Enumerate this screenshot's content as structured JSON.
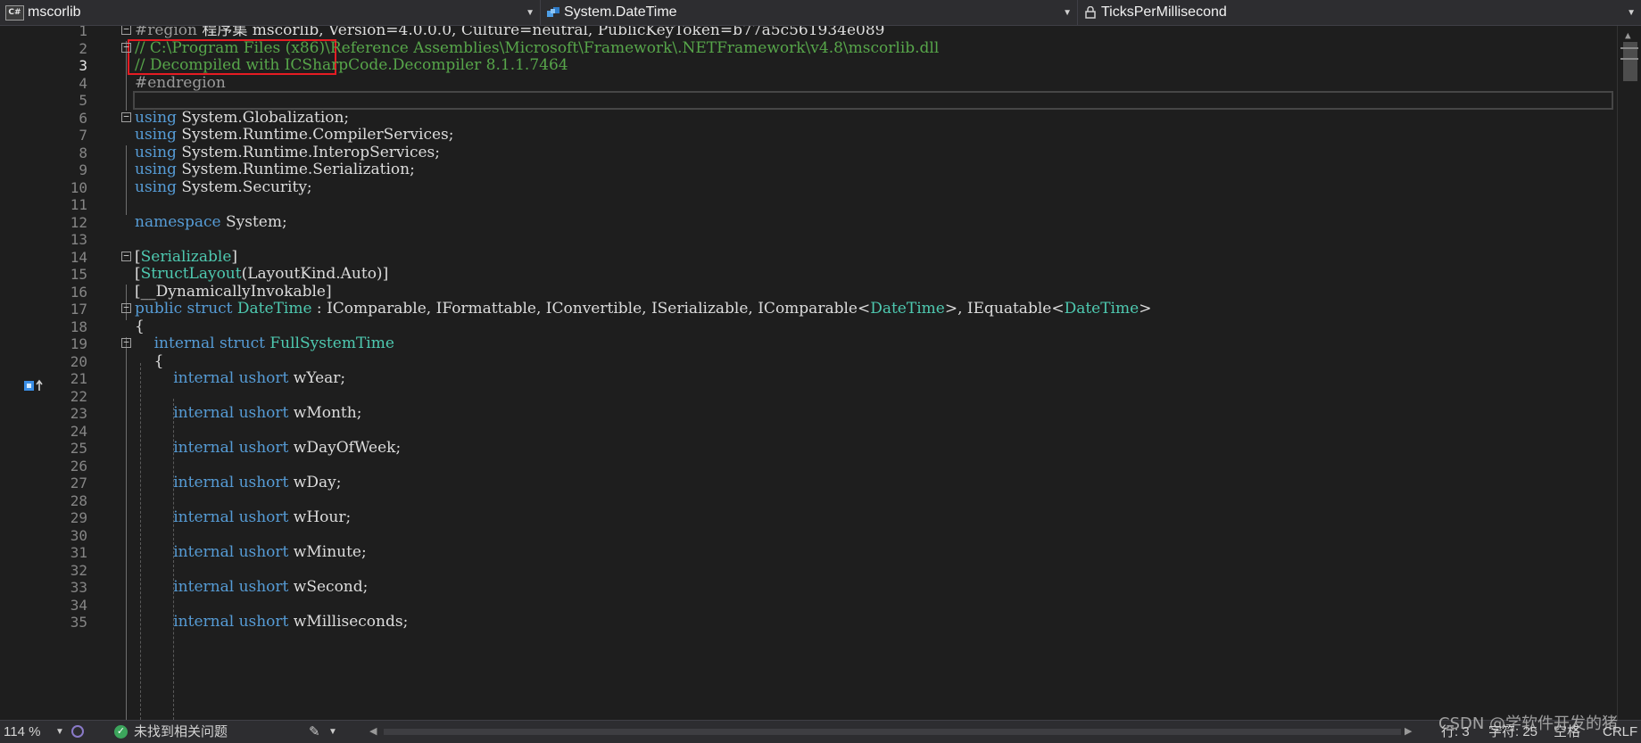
{
  "nav": {
    "project": "mscorlib",
    "project_icon": "C#",
    "type": "System.DateTime",
    "member": "TicksPerMillisecond"
  },
  "code_lines": [
    {
      "n": "1",
      "fold": "minus",
      "spans": [
        [
          "pp",
          "#region "
        ],
        [
          "pl",
          "程序集 mscorlib, Version=4.0.0.0, Culture=neutral, PublicKeyToken=b77a5c561934e089"
        ]
      ]
    },
    {
      "n": "2",
      "fold": "minus",
      "spans": [
        [
          "cm",
          "// C:\\Program Files (x86)\\Reference Assemblies\\Microsoft\\Framework\\.NETFramework\\v4.8\\mscorlib.dll"
        ]
      ]
    },
    {
      "n": "3",
      "fold": "",
      "spans": [
        [
          "cm",
          "// Decompiled with ICSharpCode.Decompiler 8.1.1.7464"
        ]
      ]
    },
    {
      "n": "4",
      "fold": "",
      "spans": [
        [
          "pp",
          "#endregion"
        ]
      ]
    },
    {
      "n": "5",
      "fold": "",
      "spans": []
    },
    {
      "n": "6",
      "fold": "minus",
      "spans": [
        [
          "kw",
          "using"
        ],
        [
          "pl",
          " System.Globalization;"
        ]
      ]
    },
    {
      "n": "7",
      "fold": "",
      "spans": [
        [
          "kw",
          "using"
        ],
        [
          "pl",
          " System.Runtime.CompilerServices;"
        ]
      ]
    },
    {
      "n": "8",
      "fold": "",
      "spans": [
        [
          "kw",
          "using"
        ],
        [
          "pl",
          " System.Runtime.InteropServices;"
        ]
      ]
    },
    {
      "n": "9",
      "fold": "",
      "spans": [
        [
          "kw",
          "using"
        ],
        [
          "pl",
          " System.Runtime.Serialization;"
        ]
      ]
    },
    {
      "n": "10",
      "fold": "",
      "spans": [
        [
          "kw",
          "using"
        ],
        [
          "pl",
          " System.Security;"
        ]
      ]
    },
    {
      "n": "11",
      "fold": "",
      "spans": []
    },
    {
      "n": "12",
      "fold": "",
      "spans": [
        [
          "kw",
          "namespace"
        ],
        [
          "pl",
          " System;"
        ]
      ]
    },
    {
      "n": "13",
      "fold": "",
      "spans": []
    },
    {
      "n": "14",
      "fold": "minus",
      "spans": [
        [
          "pl",
          "["
        ],
        [
          "ty",
          "Serializable"
        ],
        [
          "pl",
          "]"
        ]
      ]
    },
    {
      "n": "15",
      "fold": "",
      "spans": [
        [
          "pl",
          "["
        ],
        [
          "ty",
          "StructLayout"
        ],
        [
          "pl",
          "(LayoutKind.Auto)]"
        ]
      ]
    },
    {
      "n": "16",
      "fold": "",
      "spans": [
        [
          "pl",
          "[__DynamicallyInvokable]"
        ]
      ]
    },
    {
      "n": "17",
      "fold": "minus",
      "spans": [
        [
          "kw",
          "public struct "
        ],
        [
          "ty",
          "DateTime"
        ],
        [
          "pl",
          " : IComparable, IFormattable, IConvertible, ISerializable, IComparable<"
        ],
        [
          "ty",
          "DateTime"
        ],
        [
          "pl",
          ">, IEquatable<"
        ],
        [
          "ty",
          "DateTime"
        ],
        [
          "pl",
          ">"
        ]
      ]
    },
    {
      "n": "18",
      "fold": "",
      "spans": [
        [
          "pl",
          "{"
        ]
      ]
    },
    {
      "n": "19",
      "fold": "minus",
      "spans": [
        [
          "pl",
          "    "
        ],
        [
          "kw",
          "internal struct "
        ],
        [
          "ty",
          "FullSystemTime"
        ]
      ]
    },
    {
      "n": "20",
      "fold": "",
      "spans": [
        [
          "pl",
          "    {"
        ]
      ]
    },
    {
      "n": "21",
      "fold": "",
      "spans": [
        [
          "pl",
          "        "
        ],
        [
          "kw",
          "internal ushort"
        ],
        [
          "pl",
          " wYear;"
        ]
      ]
    },
    {
      "n": "22",
      "fold": "",
      "spans": []
    },
    {
      "n": "23",
      "fold": "",
      "spans": [
        [
          "pl",
          "        "
        ],
        [
          "kw",
          "internal ushort"
        ],
        [
          "pl",
          " wMonth;"
        ]
      ]
    },
    {
      "n": "24",
      "fold": "",
      "spans": []
    },
    {
      "n": "25",
      "fold": "",
      "spans": [
        [
          "pl",
          "        "
        ],
        [
          "kw",
          "internal ushort"
        ],
        [
          "pl",
          " wDayOfWeek;"
        ]
      ]
    },
    {
      "n": "26",
      "fold": "",
      "spans": []
    },
    {
      "n": "27",
      "fold": "",
      "spans": [
        [
          "pl",
          "        "
        ],
        [
          "kw",
          "internal ushort"
        ],
        [
          "pl",
          " wDay;"
        ]
      ]
    },
    {
      "n": "28",
      "fold": "",
      "spans": []
    },
    {
      "n": "29",
      "fold": "",
      "spans": [
        [
          "pl",
          "        "
        ],
        [
          "kw",
          "internal ushort"
        ],
        [
          "pl",
          " wHour;"
        ]
      ]
    },
    {
      "n": "30",
      "fold": "",
      "spans": []
    },
    {
      "n": "31",
      "fold": "",
      "spans": [
        [
          "pl",
          "        "
        ],
        [
          "kw",
          "internal ushort"
        ],
        [
          "pl",
          " wMinute;"
        ]
      ]
    },
    {
      "n": "32",
      "fold": "",
      "spans": []
    },
    {
      "n": "33",
      "fold": "",
      "spans": [
        [
          "pl",
          "        "
        ],
        [
          "kw",
          "internal ushort"
        ],
        [
          "pl",
          " wSecond;"
        ]
      ]
    },
    {
      "n": "34",
      "fold": "",
      "spans": []
    },
    {
      "n": "35",
      "fold": "",
      "spans": [
        [
          "pl",
          "        "
        ],
        [
          "kw",
          "internal ushort"
        ],
        [
          "pl",
          " wMilliseconds;"
        ]
      ]
    }
  ],
  "current_line": "3",
  "status": {
    "zoom": "114 %",
    "issues": "未找到相关问题",
    "row": "行: 3",
    "col": "字符: 25",
    "indent": "空格",
    "eol": "CRLF"
  },
  "watermark": "CSDN @学软件开发的猪",
  "colors": {
    "keyword": "#569cd6",
    "type": "#4ec9b0",
    "comment": "#57a64a",
    "preprocessor": "#9b9b9b",
    "highlight_box": "#e51c23"
  }
}
